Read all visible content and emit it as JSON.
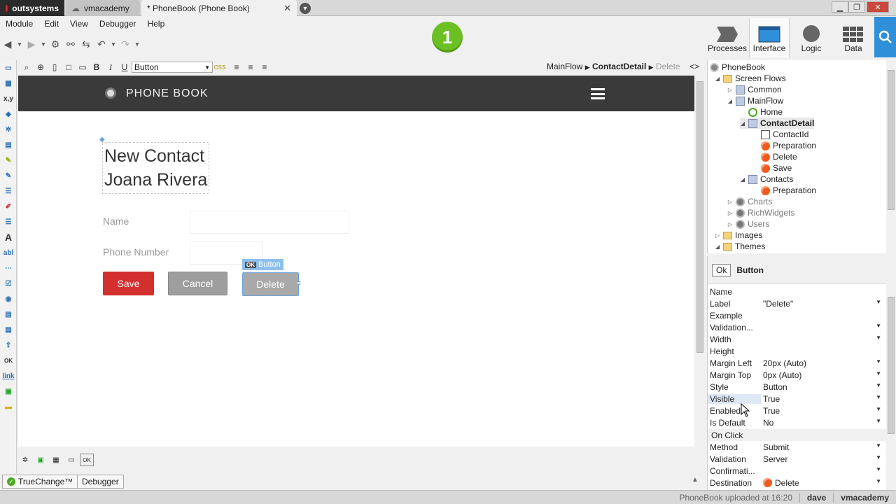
{
  "browser": {
    "tabs": [
      {
        "label": "outsystems"
      },
      {
        "label": "vmacademy"
      },
      {
        "label": "* PhoneBook (Phone Book)"
      }
    ],
    "close_glyph": "✕"
  },
  "menu": {
    "items": [
      "Module",
      "Edit",
      "View",
      "Debugger",
      "Help"
    ]
  },
  "badge": {
    "value": "1"
  },
  "nav": {
    "processes": "Processes",
    "interface": "Interface",
    "logic": "Logic",
    "data": "Data"
  },
  "editor": {
    "widget_select": "Button",
    "breadcrumb": {
      "flow": "MainFlow",
      "screen": "ContactDetail",
      "item": "Delete"
    },
    "code_toggle": "<>"
  },
  "canvas": {
    "app_title": "PHONE BOOK",
    "heading_line1": "New Contact",
    "heading_line2": "Joana Rivera",
    "name_label": "Name",
    "phone_label": "Phone Number",
    "save_label": "Save",
    "cancel_label": "Cancel",
    "delete_label": "Delete",
    "selection_tag": "Button",
    "selection_ok": "OK"
  },
  "bottom_tabs": {
    "truechange": "TrueChange™",
    "debugger": "Debugger"
  },
  "tree": {
    "root": "PhoneBook",
    "screen_flows": "Screen Flows",
    "common": "Common",
    "mainflow": "MainFlow",
    "home": "Home",
    "contactdetail": "ContactDetail",
    "contactid": "ContactId",
    "preparation1": "Preparation",
    "delete": "Delete",
    "save": "Save",
    "contacts": "Contacts",
    "preparation2": "Preparation",
    "charts": "Charts",
    "richwidgets": "RichWidgets",
    "users": "Users",
    "images": "Images",
    "themes": "Themes"
  },
  "props": {
    "header_ok": "Ok",
    "header_title": "Button",
    "rows": [
      {
        "name": "Name",
        "value": ""
      },
      {
        "name": "Label",
        "value": "\"Delete\""
      },
      {
        "name": "Example",
        "value": ""
      },
      {
        "name": "Validation...",
        "value": ""
      },
      {
        "name": "Width",
        "value": ""
      },
      {
        "name": "Height",
        "value": ""
      },
      {
        "name": "Margin Left",
        "value": "20px (Auto)"
      },
      {
        "name": "Margin Top",
        "value": "0px (Auto)"
      },
      {
        "name": "Style",
        "value": "Button"
      },
      {
        "name": "Visible",
        "value": "True"
      },
      {
        "name": "Enabled",
        "value": "True"
      },
      {
        "name": "Is Default",
        "value": "No"
      }
    ],
    "section_onclick": "On Click",
    "rows2": [
      {
        "name": "Method",
        "value": "Submit"
      },
      {
        "name": "Validation",
        "value": "Server"
      },
      {
        "name": "Confirmati...",
        "value": ""
      },
      {
        "name": "Destination",
        "value": "Delete"
      }
    ]
  },
  "status": {
    "message": "PhoneBook uploaded at 16:20",
    "user": "dave",
    "server": "vmacademy"
  },
  "colors": {
    "accent": "#2f8fd8",
    "save": "#d32f2f",
    "badge": "#6cc024"
  }
}
